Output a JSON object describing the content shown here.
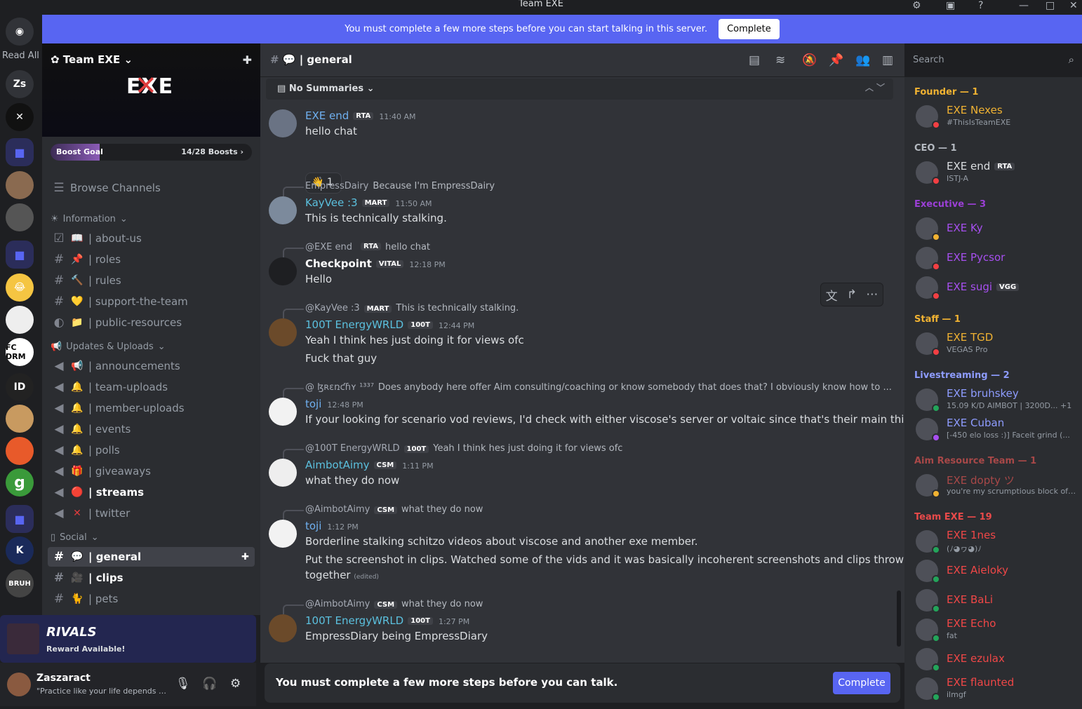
{
  "window": {
    "title": "Team EXE"
  },
  "banner": {
    "text": "You must complete a few more steps before you can start talking in this server.",
    "button": "Complete"
  },
  "serverbar": {
    "read_all": "Read All",
    "items": [
      "Zs",
      "FC DRM",
      "g",
      "BRUH"
    ]
  },
  "guild": {
    "name": "Team EXE",
    "logo_text": "EXE",
    "boost_label": "Boost Goal",
    "boost_count": "14/28 Boosts",
    "boost_progress": 0.5
  },
  "channels": {
    "browse": "Browse Channels",
    "categories": [
      {
        "name": "Information",
        "items": [
          "| about-us",
          "| roles",
          "| rules",
          "| support-the-team",
          "| public-resources"
        ]
      },
      {
        "name": "Updates & Uploads",
        "items": [
          "| announcements",
          "| team-uploads",
          "| member-uploads",
          "| events",
          "| polls",
          "| giveaways",
          "| streams",
          "| twitter"
        ]
      },
      {
        "name": "Social",
        "items": [
          "| general",
          "| clips",
          "| pets"
        ]
      }
    ]
  },
  "rivals": {
    "logo": "RIVALS",
    "sub": "Reward Available!"
  },
  "user": {
    "name": "Zaszaract",
    "status": "\"Practice like your life depends o..."
  },
  "header": {
    "channel": "| general",
    "search_placeholder": "Search"
  },
  "chat": {
    "summaries": "No Summaries",
    "messages": [
      {
        "name": "EXE end",
        "tag": "RTA",
        "time": "11:40 AM",
        "color": "#6fb0f0",
        "lines": [
          "hello chat"
        ],
        "reaction": "1"
      },
      {
        "reply_name": "EmpressDairy",
        "reply_text": "Because I'm EmpressDairy",
        "name": "KayVee :3",
        "tag": "MART",
        "time": "11:50 AM",
        "color": "#5bc0de",
        "lines": [
          "This is technically stalking."
        ]
      },
      {
        "reply_name": "@EXE end",
        "reply_tag": "RTA",
        "reply_text": "hello chat",
        "name": "Checkpoint",
        "tag": "VITAL",
        "time": "12:18 PM",
        "color": "#ffffff",
        "lines": [
          "Hello"
        ]
      },
      {
        "reply_name": "@KayVee :3",
        "reply_tag": "MART",
        "reply_text": "This is technically stalking.",
        "name": "100T EnergyWRLD",
        "tag": "100T",
        "time": "12:44 PM",
        "color": "#5bc0de",
        "lines": [
          "Yeah I think hes just doing it for views ofc",
          "Fuck that guy"
        ]
      },
      {
        "reply_name": "@ ɮʀɛռƈɦʏ ¹³³⁷",
        "reply_text": "Does anybody here offer Aim consulting/coaching or know somebody that does that? I obviously know how to ...",
        "name": "toji",
        "time": "12:48 PM",
        "color": "#6fb0f0",
        "lines": [
          "If your looking for scenario vod reviews, I'd check with either viscose's server or voltaic since that's their main thing."
        ]
      },
      {
        "reply_name": "@100T EnergyWRLD",
        "reply_tag": "100T",
        "reply_text": "Yeah I think hes just doing it for views ofc",
        "name": "AimbotAimy",
        "tag": "CSM",
        "time": "1:11 PM",
        "color": "#5bc0de",
        "lines": [
          "what they do now"
        ]
      },
      {
        "reply_name": "@AimbotAimy",
        "reply_tag": "CSM",
        "reply_text": "what they do now",
        "name": "toji",
        "time": "1:12 PM",
        "color": "#6fb0f0",
        "lines": [
          "Borderline stalking schitzo videos about viscose and another exe member.",
          "Put the screenshot in clips. Watched some of the vids and it was basically incoherent screenshots and clips thrown",
          "together"
        ],
        "edited": "(edited)"
      },
      {
        "reply_name": "@AimbotAimy",
        "reply_tag": "CSM",
        "reply_text": "what they do now",
        "name": "100T EnergyWRLD",
        "tag": "100T",
        "time": "1:27 PM",
        "color": "#5bc0de",
        "lines": [
          "EmpressDiary being EmpressDiary"
        ]
      }
    ]
  },
  "composer": {
    "text": "You must complete a few more steps before you can talk.",
    "button": "Complete"
  },
  "members": {
    "groups": [
      {
        "title": "Founder — 1",
        "color": "#f0b232",
        "people": [
          {
            "name": "EXE Nexes",
            "sub": "#ThisIsTeamEXE",
            "color": "#f0b232",
            "status": "#f23f43"
          }
        ]
      },
      {
        "title": "CEO — 1",
        "color": "#b5bac1",
        "people": [
          {
            "name": "EXE end",
            "tag": "RTA",
            "sub": "ISTJ-A",
            "color": "#dbdee1",
            "status": "#f23f43"
          }
        ]
      },
      {
        "title": "Executive — 3",
        "color": "#9b3fd6",
        "people": [
          {
            "name": "EXE Ky",
            "color": "#a74ff0",
            "status": "#f0b232"
          },
          {
            "name": "EXE Pycsor",
            "color": "#a74ff0",
            "status": "#f23f43"
          },
          {
            "name": "EXE sugi",
            "tag": "VGG",
            "color": "#a74ff0",
            "status": "#f23f43"
          }
        ]
      },
      {
        "title": "Staff — 1",
        "color": "#f0b232",
        "people": [
          {
            "name": "EXE TGD",
            "sub": "VEGAS Pro",
            "color": "#f0b232",
            "status": "#f23f43"
          }
        ]
      },
      {
        "title": "Livestreaming — 2",
        "color": "#8e9cff",
        "people": [
          {
            "name": "EXE bruhskey",
            "sub": "15.09 K/D AIMBOT | 3200D... +1",
            "color": "#8e9cff",
            "status": "#23a55a"
          },
          {
            "name": "EXE Cuban",
            "sub": "[-450 elo loss :)] Faceit grind (...",
            "color": "#8e9cff",
            "status": "#a74ff0"
          }
        ]
      },
      {
        "title": "Aim Resource Team — 1",
        "color": "#a84848",
        "people": [
          {
            "name": "EXE dopty ツ",
            "sub": "you're my scrumptious block of c...",
            "color": "#a84848",
            "status": "#f0b232"
          }
        ]
      },
      {
        "title": "Team EXE — 19",
        "color": "#e84a4a",
        "people": [
          {
            "name": "EXE 1nes",
            "sub": "(ﾉ◕ヮ◕)ﾉ",
            "color": "#f04747",
            "status": "#23a55a"
          },
          {
            "name": "EXE Aieloky",
            "color": "#f04747",
            "status": "#23a55a"
          },
          {
            "name": "EXE BaLi",
            "color": "#f04747",
            "status": "#23a55a"
          },
          {
            "name": "EXE Echo",
            "sub": "fat",
            "color": "#f04747",
            "status": "#23a55a"
          },
          {
            "name": "EXE ezulax",
            "color": "#f04747",
            "status": "#23a55a"
          },
          {
            "name": "EXE flaunted",
            "sub": "ilmgf",
            "color": "#f04747",
            "status": "#23a55a"
          }
        ]
      }
    ]
  }
}
